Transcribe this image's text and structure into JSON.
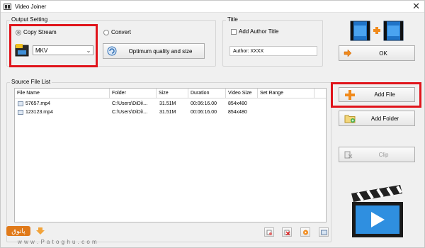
{
  "window": {
    "title": "Video Joiner",
    "close_glyph": "✕"
  },
  "output_setting": {
    "legend": "Output Setting",
    "copy_stream_label": "Copy Stream",
    "convert_label": "Convert",
    "format_value": "MKV",
    "quality_button": "Optimum quality and size"
  },
  "title_group": {
    "legend": "Title",
    "add_author_label": "Add Author Title",
    "author_value": "Author: XXXX"
  },
  "ok_button": "OK",
  "source_list": {
    "legend": "Source File List",
    "columns": [
      "File Name",
      "Folder",
      "Size",
      "Duration",
      "Video Size",
      "Set Range"
    ],
    "rows": [
      {
        "name": "57657.mp4",
        "folder": "C:\\Users\\DiDi\\...",
        "size": "31.51M",
        "duration": "00:06:16.00",
        "video_size": "854x480"
      },
      {
        "name": "123123.mp4",
        "folder": "C:\\Users\\DiDi\\...",
        "size": "31.51M",
        "duration": "00:06:16.00",
        "video_size": "854x480"
      }
    ]
  },
  "side_buttons": {
    "add_file": "Add File",
    "add_folder": "Add Folder",
    "clip": "Clip"
  },
  "watermark": {
    "text": "w w w . P a t o g h u . c o m",
    "logo_text": "پاتوق"
  },
  "colors": {
    "highlight_red": "#e0141b",
    "plus_orange": "#f08a1c",
    "film_blue": "#1f73c7"
  }
}
